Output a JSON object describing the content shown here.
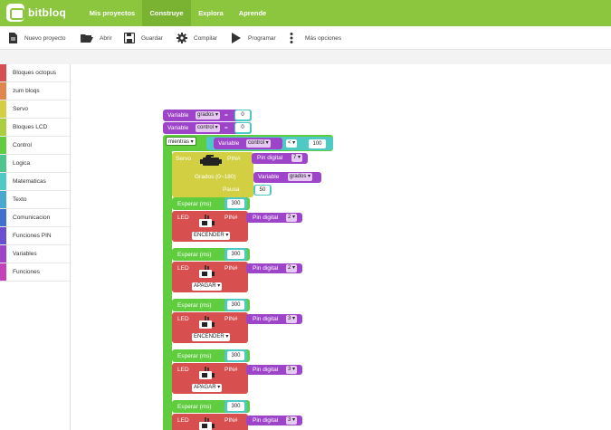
{
  "app": {
    "brand": "bitbloq",
    "brand_color": "#8cc63e"
  },
  "nav": [
    "Mis proyectos",
    "Construye",
    "Explora",
    "Aprende"
  ],
  "toolbar": [
    "Nuevo proyecto",
    "Abrir",
    "Guardar",
    "Compilar",
    "Programar",
    "Más opciones"
  ],
  "sidebar": [
    {
      "label": "Bloques octopus",
      "color": "#d84f4f"
    },
    {
      "label": "zum bloqs",
      "color": "#e0864b"
    },
    {
      "label": "Servo",
      "color": "#d2d042"
    },
    {
      "label": "Bloques LCD",
      "color": "#a9cf3e"
    },
    {
      "label": "Control",
      "color": "#5fcd3f"
    },
    {
      "label": "Logica",
      "color": "#4ec58c"
    },
    {
      "label": "Matematicas",
      "color": "#4ec9c3"
    },
    {
      "label": "Texto",
      "color": "#49a8cf"
    },
    {
      "label": "Comunicacion",
      "color": "#3f72cf"
    },
    {
      "label": "Funciones PIN",
      "color": "#6b4fd1"
    },
    {
      "label": "Variables",
      "color": "#9d44c9"
    },
    {
      "label": "Funciones",
      "color": "#c541ba"
    }
  ],
  "blocks": {
    "var1": {
      "label": "Variable",
      "name": "grados",
      "op": "=",
      "value": "0"
    },
    "var2": {
      "label": "Variable",
      "name": "control",
      "op": "=",
      "value": "0"
    },
    "loop": {
      "keyword": "mientras",
      "cond_label": "Variable",
      "cond_name": "control",
      "cond_op": "< ▾",
      "cond_value": "100"
    },
    "servo": {
      "label": "Servo",
      "pin_label": "PIN#",
      "pin_value": "Pin digital",
      "pin_num": "7",
      "deg_label": "Grados (0~180)",
      "deg_var_label": "Variable",
      "deg_var": "grados",
      "pause_label": "Pausa",
      "pause_value": "50"
    },
    "wait_label": "Esperar (ms)",
    "wait_value": "300",
    "led_label": "LED",
    "led_pin_label": "PIN#",
    "led_pin_value": "Pin digital",
    "led_seq": [
      {
        "pin": "2",
        "state": "ENCENDER ▾"
      },
      {
        "pin": "2",
        "state": "APAGAR ▾"
      },
      {
        "pin": "3",
        "state": "ENCENDER ▾"
      },
      {
        "pin": "3",
        "state": "APAGAR ▾"
      },
      {
        "pin": "3",
        "state": ""
      }
    ]
  }
}
